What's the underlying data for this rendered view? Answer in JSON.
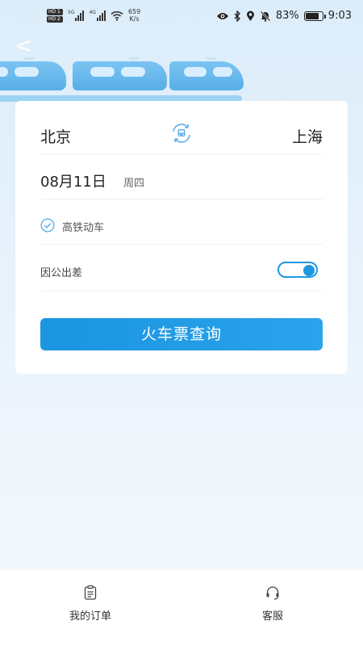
{
  "status_bar": {
    "hd1": "HD 1",
    "hd2": "HD 2",
    "net1": "5G",
    "net2": "4G",
    "speed_value": "659",
    "speed_unit": "K/s",
    "battery_percent": "83%",
    "battery_level": 0.83,
    "time": "9:03"
  },
  "header": {
    "back_label": "<"
  },
  "route": {
    "from_city": "北京",
    "to_city": "上海"
  },
  "travel_date": {
    "date": "08月11日",
    "weekday": "周四"
  },
  "train_type": {
    "label": "高铁动车",
    "checked": true
  },
  "business_trip": {
    "label": "因公出差",
    "enabled": true
  },
  "search_button": {
    "label": "火车票查询"
  },
  "bottom_nav": {
    "items": [
      {
        "label": "我的订单",
        "icon": "clipboard-icon"
      },
      {
        "label": "客服",
        "icon": "headset-icon"
      }
    ]
  },
  "colors": {
    "accent": "#1e98e1",
    "train": "#66b8eb"
  }
}
